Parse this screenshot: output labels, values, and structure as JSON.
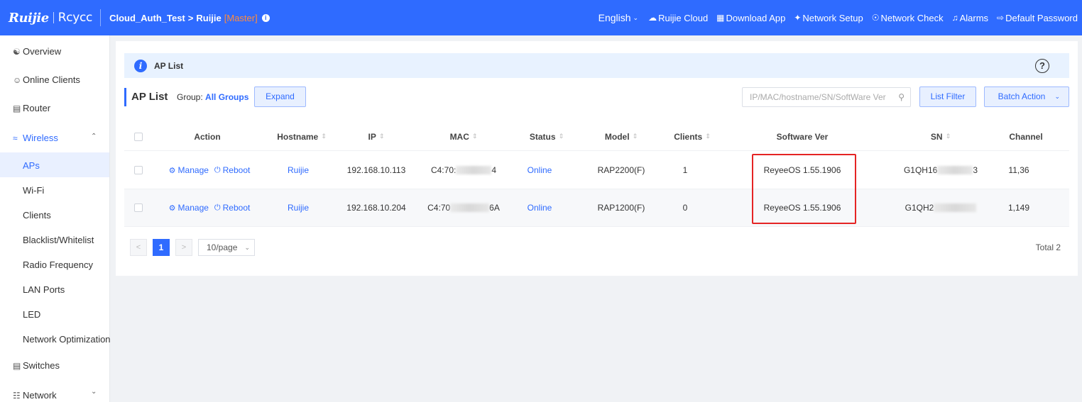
{
  "brand": {
    "logo_left": "Ruijie",
    "logo_right": "Rcycc"
  },
  "breadcrumb": {
    "project": "Cloud_Auth_Test",
    "separator": ">",
    "device": "Ruijie",
    "role": "[Master]",
    "info_icon": "i"
  },
  "topnav": {
    "language": "English",
    "items": [
      {
        "label": "Ruijie Cloud",
        "icon": "cloud-icon"
      },
      {
        "label": "Download App",
        "icon": "qr-code-icon"
      },
      {
        "label": "Network Setup",
        "icon": "wand-icon"
      },
      {
        "label": "Network Check",
        "icon": "check-circle-icon"
      },
      {
        "label": "Alarms",
        "icon": "bell-icon"
      },
      {
        "label": "Default Password",
        "icon": "logout-icon"
      }
    ]
  },
  "sidebar": {
    "items": [
      {
        "label": "Overview",
        "icon": "topology-icon"
      },
      {
        "label": "Online Clients",
        "icon": "user-circle-icon"
      },
      {
        "label": "Router",
        "icon": "router-icon"
      },
      {
        "label": "Wireless",
        "icon": "wifi-icon"
      },
      {
        "label": "Switches",
        "icon": "switch-icon"
      },
      {
        "label": "Network",
        "icon": "network-icon"
      }
    ],
    "wireless_sub": [
      "APs",
      "Wi-Fi",
      "Clients",
      "Blacklist/Whitelist",
      "Radio Frequency",
      "LAN Ports",
      "LED",
      "Network Optimization"
    ],
    "active_sub": "APs"
  },
  "banner": {
    "title": "AP List",
    "help": "?"
  },
  "toolbar": {
    "heading": "AP List",
    "group_label": "Group:",
    "group_value": "All Groups",
    "expand": "Expand",
    "search_placeholder": "IP/MAC/hostname/SN/SoftWare Ver",
    "list_filter": "List Filter",
    "batch_action": "Batch Action"
  },
  "table": {
    "headers": [
      "Action",
      "Hostname",
      "IP",
      "MAC",
      "Status",
      "Model",
      "Clients",
      "Software Ver",
      "SN",
      "Channel"
    ],
    "action_manage": "Manage",
    "action_reboot": "Reboot",
    "rows": [
      {
        "hostname": "Ruijie",
        "ip": "192.168.10.113",
        "mac_start": "C4:70:",
        "mac_end": "4",
        "status": "Online",
        "model": "RAP2200(F)",
        "clients": "1",
        "software": "ReyeeOS 1.55.1906",
        "sn_start": "G1QH16",
        "sn_end": "3",
        "channel": "11,36"
      },
      {
        "hostname": "Ruijie",
        "ip": "192.168.10.204",
        "mac_start": "C4:70",
        "mac_end": "6A",
        "status": "Online",
        "model": "RAP1200(F)",
        "clients": "0",
        "software": "ReyeeOS 1.55.1906",
        "sn_start": "G1QH2",
        "sn_end": "",
        "channel": "1,149"
      }
    ]
  },
  "pagination": {
    "prev": "<",
    "page": "1",
    "next": ">",
    "page_size": "10/page",
    "total": "Total 2"
  },
  "colors": {
    "primary": "#2f6bff",
    "highlight_box": "#e52424",
    "master_tag": "#ff8a3d"
  }
}
